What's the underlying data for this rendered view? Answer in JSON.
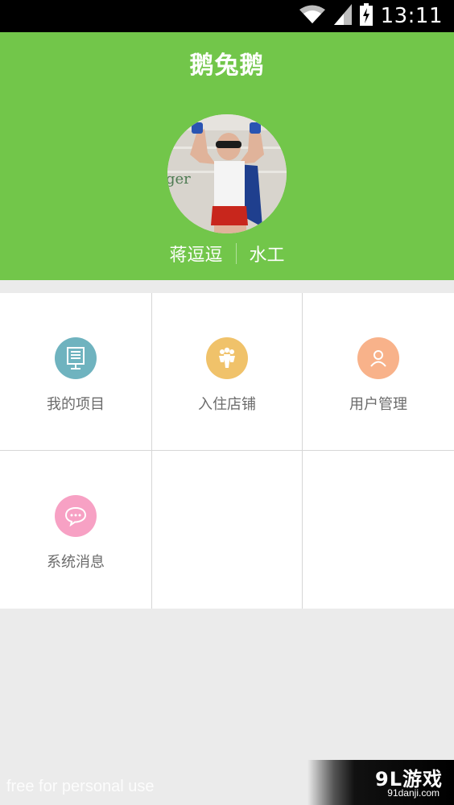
{
  "status_bar": {
    "time": "13:11",
    "icons": [
      "wifi-icon",
      "signal-icon",
      "battery-charging-icon"
    ]
  },
  "header": {
    "title": "鹅兔鹅",
    "background_color": "#72c64a"
  },
  "user": {
    "name": "蒋逗逗",
    "role": "水工"
  },
  "menu": {
    "items": [
      {
        "label": "我的项目",
        "icon": "project-list-icon",
        "color": "#6fb3bf"
      },
      {
        "label": "入住店铺",
        "icon": "group-people-icon",
        "color": "#f0c26a"
      },
      {
        "label": "用户管理",
        "icon": "user-icon",
        "color": "#f8b28a"
      },
      {
        "label": "系统消息",
        "icon": "chat-bubble-icon",
        "color": "#f7a1c4"
      }
    ]
  },
  "watermark": {
    "text": "free for personal use"
  },
  "badge": {
    "title": "9L游戏",
    "url": "91danji.com"
  }
}
